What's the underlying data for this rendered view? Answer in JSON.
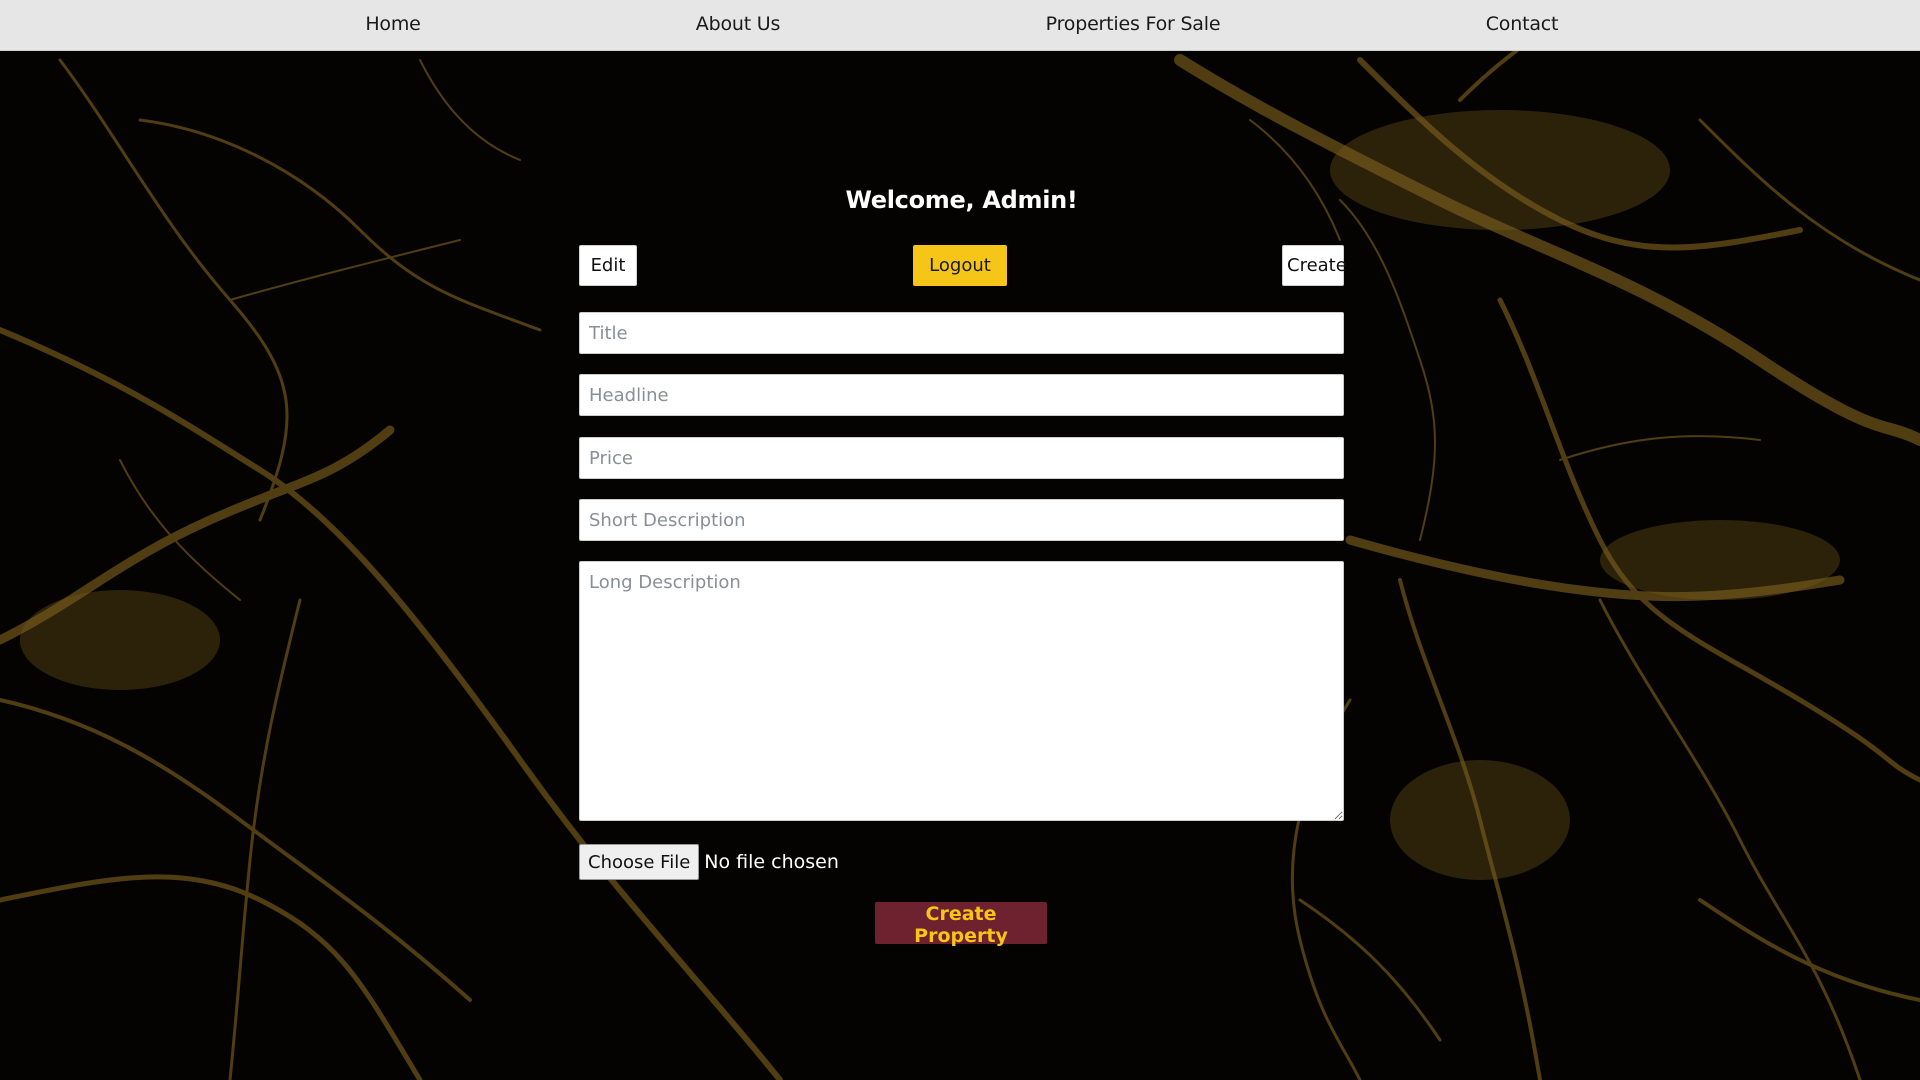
{
  "colors": {
    "nav_background": "#e6e6e6",
    "page_background": "#050403",
    "marble_vein": "#8a6a1f",
    "logout_button": "#f5c518",
    "submit_button": "#6e2230",
    "submit_text": "#f5c518"
  },
  "nav": {
    "items": [
      {
        "label": "Home"
      },
      {
        "label": "About Us"
      },
      {
        "label": "Properties For Sale"
      },
      {
        "label": "Contact"
      }
    ]
  },
  "admin": {
    "welcome": "Welcome, Admin!",
    "edit_label": "Edit",
    "logout_label": "Logout",
    "create_label": "Create"
  },
  "form": {
    "title_placeholder": "Title",
    "headline_placeholder": "Headline",
    "price_placeholder": "Price",
    "short_description_placeholder": "Short Description",
    "long_description_placeholder": "Long Description",
    "file_button_label": "Choose File",
    "file_status": "No file chosen",
    "submit_label": "Create Property"
  }
}
